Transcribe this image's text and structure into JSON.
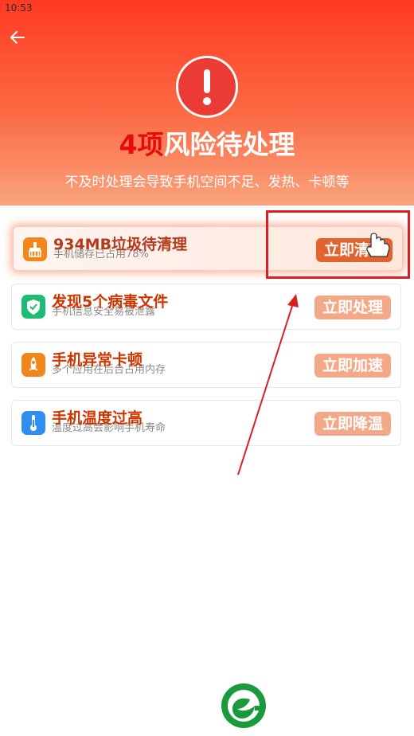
{
  "status_bar": {
    "time": "10:53"
  },
  "header": {
    "title_number": "4项",
    "title_rest": "风险待处理",
    "subtitle": "不及时处理会导致手机空间不足、发热、卡顿等"
  },
  "risk_items": [
    {
      "title": "934MB垃圾待清理",
      "desc": "手机储存已占用78%",
      "action": "立即清理",
      "icon": "broom-icon",
      "color": "#f3861b"
    },
    {
      "title": "发现5个病毒文件",
      "desc": "手机信息安全易被泄露",
      "action": "立即处理",
      "icon": "shield-icon",
      "color": "#1dbb74"
    },
    {
      "title": "手机异常卡顿",
      "desc": "多个应用在后台占用内存",
      "action": "立即加速",
      "icon": "rocket-icon",
      "color": "#f3861b"
    },
    {
      "title": "手机温度过高",
      "desc": "温度过高会影响手机寿命",
      "action": "立即降温",
      "icon": "thermometer-icon",
      "color": "#2f8ff0"
    }
  ],
  "colors": {
    "header_top": "#ff3a22",
    "header_bottom": "#f9a37c",
    "accent": "#e80b0b",
    "annotation": "#d92020",
    "logo_green": "#1a9a3a"
  }
}
